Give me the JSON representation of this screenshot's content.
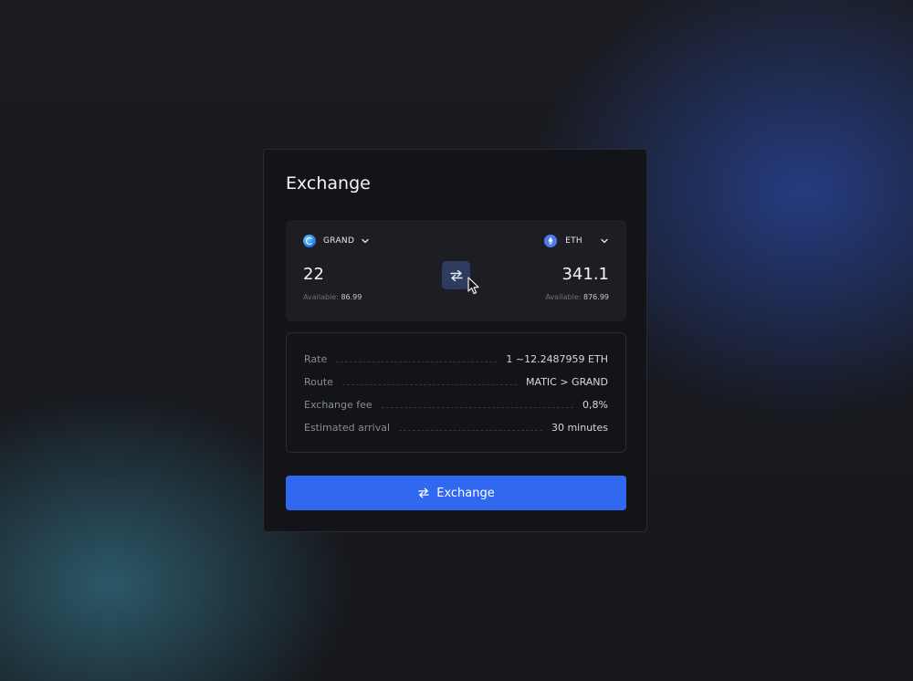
{
  "card": {
    "title": "Exchange"
  },
  "swap": {
    "from": {
      "token": "GRAND",
      "icon": "grand-token-icon",
      "amount": "22",
      "available_label": "Available:",
      "available_value": "86.99"
    },
    "to": {
      "token": "ETH",
      "icon": "eth-token-icon",
      "amount": "341.1",
      "available_label": "Available:",
      "available_value": "876.99"
    },
    "swap_icon": "swap-arrows-icon"
  },
  "details": [
    {
      "label": "Rate",
      "value": "1 ~12.2487959 ETH"
    },
    {
      "label": "Route",
      "value": "MATIC > GRAND"
    },
    {
      "label": "Exchange fee",
      "value": "0,8%"
    },
    {
      "label": "Estimated arrival",
      "value": "30 minutes"
    }
  ],
  "action": {
    "label": "Exchange",
    "icon": "swap-arrows-icon"
  },
  "colors": {
    "accent": "#3168f0",
    "card_bg": "#131419",
    "panel_bg": "#1d1e24",
    "swap_button_bg": "#2e3a5f"
  }
}
